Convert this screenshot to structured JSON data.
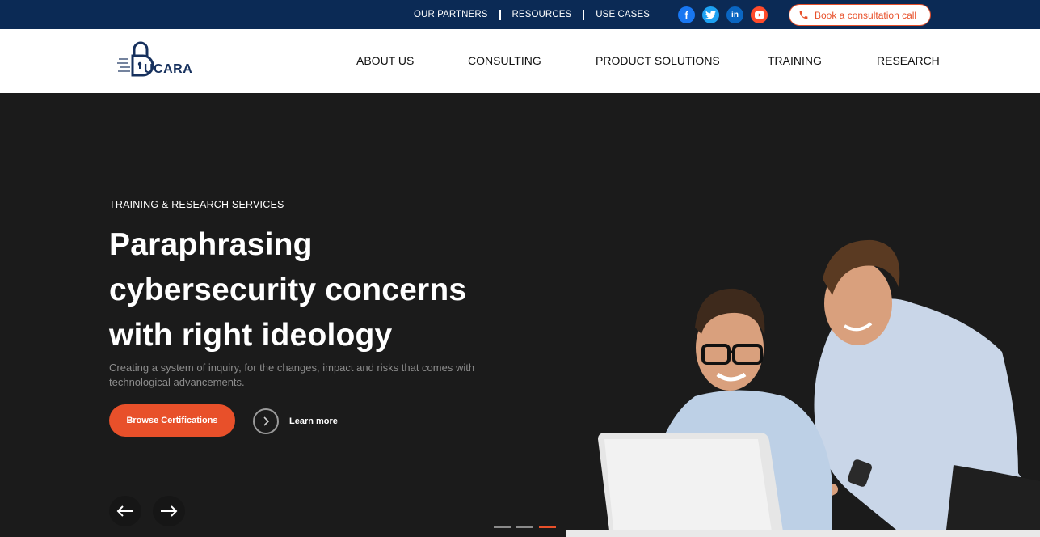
{
  "topbar": {
    "links": [
      "OUR PARTNERS",
      "RESOURCES",
      "USE CASES"
    ],
    "social": [
      "facebook-icon",
      "twitter-icon",
      "linkedin-icon",
      "youtube-icon"
    ],
    "consult_label": "Book a consultation call"
  },
  "brand": {
    "logo_text": "UCARA"
  },
  "nav": {
    "items": [
      "ABOUT US",
      "CONSULTING",
      "PRODUCT SOLUTIONS",
      "TRAINING",
      "RESEARCH"
    ]
  },
  "hero": {
    "eyebrow": "TRAINING & RESEARCH SERVICES",
    "headline_line1": "Paraphrasing",
    "headline_line2": "cybersecurity concerns",
    "headline_line3": "with right ideology",
    "subtitle": "Creating a system of inquiry, for the changes, impact and risks that comes with technological advancements.",
    "primary_cta": "Browse Certifications",
    "secondary_cta": "Learn more",
    "slides_total": 3,
    "slide_active": 3
  },
  "colors": {
    "topbar_bg": "#0b2a55",
    "accent": "#e8502a",
    "hero_bg": "#1b1b1b"
  }
}
